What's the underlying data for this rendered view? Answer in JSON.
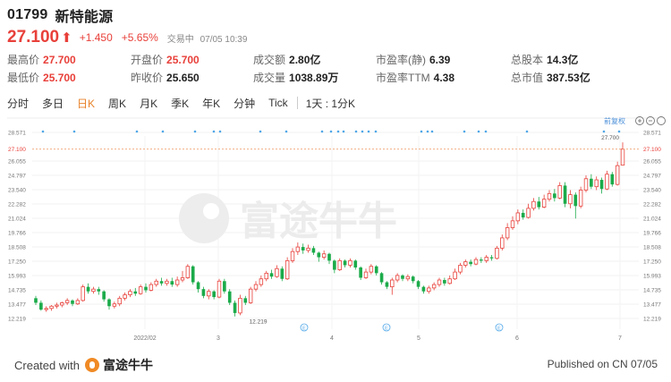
{
  "header": {
    "code": "01799",
    "name": "新特能源"
  },
  "quote": {
    "price": "27.100",
    "arrow": "⬆",
    "change": "+1.450",
    "change_pct": "+5.65%",
    "time_label": "交易中",
    "time": "07/05 10:39"
  },
  "stats": [
    {
      "label": "最高价",
      "value": "27.700",
      "color": "red"
    },
    {
      "label": "开盘价",
      "value": "25.700",
      "color": "red"
    },
    {
      "label": "成交额",
      "value": "2.80亿",
      "color": "black"
    },
    {
      "label": "市盈率(静)",
      "value": "6.39",
      "color": "black"
    },
    {
      "label": "总股本",
      "value": "14.3亿",
      "color": "black"
    },
    {
      "label": "最低价",
      "value": "25.700",
      "color": "red"
    },
    {
      "label": "昨收价",
      "value": "25.650",
      "color": "black"
    },
    {
      "label": "成交量",
      "value": "1038.89万",
      "color": "black"
    },
    {
      "label": "市盈率TTM",
      "value": "4.38",
      "color": "black"
    },
    {
      "label": "总市值",
      "value": "387.53亿",
      "color": "black"
    }
  ],
  "tabs": [
    "分时",
    "多日",
    "日K",
    "周K",
    "月K",
    "季K",
    "年K",
    "分钟",
    "Tick"
  ],
  "active_tab": "日K",
  "period": "1天 : 1分K",
  "rights_label": "前复权",
  "watermark": "富途牛牛",
  "chart_data": {
    "type": "candlestick",
    "yticks": [
      28.571,
      27.1,
      26.055,
      24.797,
      23.54,
      22.282,
      21.024,
      19.766,
      18.508,
      17.25,
      15.993,
      14.735,
      13.477,
      12.219
    ],
    "xticks": [
      "2022/02",
      "3",
      "4",
      "5",
      "6",
      "7"
    ],
    "current_price": 27.1,
    "high_label": "27.700",
    "low_label": "12.219",
    "colors": {
      "up": "#e8403a",
      "down": "#1bab4a",
      "dash": "#f0a070",
      "marker": "#4fa7e8"
    },
    "candles": [
      [
        14.0,
        13.6,
        14.2,
        13.4
      ],
      [
        13.6,
        13.0,
        13.8,
        12.9
      ],
      [
        13.0,
        13.1,
        13.3,
        12.8
      ],
      [
        13.1,
        13.3,
        13.4,
        12.9
      ],
      [
        13.3,
        13.4,
        13.6,
        13.1
      ],
      [
        13.4,
        13.6,
        13.7,
        13.2
      ],
      [
        13.6,
        13.8,
        14.0,
        13.4
      ],
      [
        13.8,
        13.5,
        13.9,
        13.3
      ],
      [
        13.5,
        13.8,
        14.0,
        13.4
      ],
      [
        13.8,
        15.0,
        15.2,
        13.7
      ],
      [
        15.0,
        14.6,
        15.3,
        14.4
      ],
      [
        14.6,
        14.8,
        15.0,
        14.4
      ],
      [
        14.8,
        14.6,
        15.0,
        14.3
      ],
      [
        14.6,
        13.9,
        14.7,
        13.7
      ],
      [
        13.9,
        13.3,
        14.0,
        13.0
      ],
      [
        13.3,
        13.5,
        13.7,
        13.1
      ],
      [
        13.5,
        14.0,
        14.2,
        13.3
      ],
      [
        14.0,
        14.3,
        14.5,
        13.8
      ],
      [
        14.3,
        14.6,
        14.8,
        14.1
      ],
      [
        14.6,
        14.4,
        14.9,
        14.2
      ],
      [
        14.4,
        15.0,
        15.2,
        14.3
      ],
      [
        15.0,
        14.7,
        15.3,
        14.5
      ],
      [
        14.7,
        15.2,
        15.4,
        14.6
      ],
      [
        15.2,
        15.5,
        15.7,
        15.0
      ],
      [
        15.5,
        15.3,
        15.8,
        15.1
      ],
      [
        15.3,
        15.5,
        15.7,
        15.1
      ],
      [
        15.5,
        15.2,
        15.8,
        15.0
      ],
      [
        15.2,
        15.6,
        15.9,
        15.0
      ],
      [
        15.6,
        15.8,
        16.4,
        15.4
      ],
      [
        15.8,
        16.8,
        17.0,
        15.7
      ],
      [
        16.8,
        15.4,
        16.9,
        15.2
      ],
      [
        15.4,
        14.8,
        15.5,
        14.5
      ],
      [
        14.8,
        14.2,
        15.0,
        14.0
      ],
      [
        14.2,
        14.6,
        14.8,
        13.9
      ],
      [
        14.6,
        14.1,
        14.7,
        13.9
      ],
      [
        14.1,
        15.5,
        15.7,
        14.0
      ],
      [
        15.5,
        14.6,
        15.7,
        14.4
      ],
      [
        14.6,
        13.6,
        14.8,
        13.4
      ],
      [
        13.6,
        12.7,
        13.8,
        12.4
      ],
      [
        12.7,
        14.0,
        14.3,
        12.5
      ],
      [
        14.0,
        13.6,
        14.2,
        13.4
      ],
      [
        13.6,
        14.8,
        15.0,
        13.5
      ],
      [
        14.8,
        15.2,
        15.5,
        14.6
      ],
      [
        15.2,
        15.7,
        16.0,
        15.0
      ],
      [
        15.7,
        16.2,
        16.4,
        15.5
      ],
      [
        16.2,
        15.9,
        16.5,
        15.7
      ],
      [
        15.9,
        16.6,
        16.9,
        15.8
      ],
      [
        16.6,
        15.7,
        16.8,
        15.5
      ],
      [
        15.7,
        17.3,
        17.6,
        15.6
      ],
      [
        17.3,
        18.1,
        18.4,
        17.1
      ],
      [
        18.1,
        18.5,
        18.9,
        17.8
      ],
      [
        18.5,
        18.2,
        18.8,
        17.9
      ],
      [
        18.2,
        18.4,
        18.7,
        18.0
      ],
      [
        18.4,
        18.0,
        18.6,
        17.8
      ],
      [
        18.0,
        17.6,
        18.1,
        17.2
      ],
      [
        17.6,
        17.9,
        18.2,
        17.4
      ],
      [
        17.9,
        17.3,
        18.0,
        17.0
      ],
      [
        17.3,
        16.5,
        17.4,
        16.2
      ],
      [
        16.5,
        17.3,
        17.5,
        16.4
      ],
      [
        17.3,
        16.9,
        17.4,
        16.7
      ],
      [
        16.9,
        17.3,
        17.5,
        16.7
      ],
      [
        17.3,
        16.7,
        17.4,
        16.5
      ],
      [
        16.7,
        15.8,
        16.8,
        15.6
      ],
      [
        15.8,
        16.3,
        16.6,
        15.7
      ],
      [
        16.3,
        16.8,
        17.0,
        16.1
      ],
      [
        16.8,
        16.2,
        16.9,
        16.0
      ],
      [
        16.2,
        15.4,
        16.3,
        15.2
      ],
      [
        15.4,
        15.0,
        15.5,
        14.8
      ],
      [
        15.0,
        15.6,
        15.8,
        14.3
      ],
      [
        15.6,
        16.0,
        16.2,
        15.4
      ],
      [
        16.0,
        15.7,
        16.1,
        15.5
      ],
      [
        15.7,
        15.9,
        16.1,
        15.5
      ],
      [
        15.9,
        15.5,
        16.0,
        15.3
      ],
      [
        15.5,
        15.0,
        15.6,
        14.8
      ],
      [
        15.0,
        14.6,
        15.1,
        14.4
      ],
      [
        14.6,
        14.9,
        15.1,
        14.4
      ],
      [
        14.9,
        15.2,
        15.4,
        14.7
      ],
      [
        15.2,
        15.6,
        15.8,
        15.0
      ],
      [
        15.6,
        15.3,
        15.8,
        15.1
      ],
      [
        15.3,
        15.7,
        16.0,
        15.2
      ],
      [
        15.7,
        16.3,
        16.6,
        15.6
      ],
      [
        16.3,
        16.9,
        17.1,
        16.1
      ],
      [
        16.9,
        17.2,
        17.4,
        16.7
      ],
      [
        17.2,
        17.0,
        17.4,
        16.8
      ],
      [
        17.0,
        17.4,
        17.6,
        16.9
      ],
      [
        17.4,
        17.3,
        17.6,
        17.1
      ],
      [
        17.3,
        17.6,
        17.8,
        17.1
      ],
      [
        17.6,
        17.5,
        17.8,
        17.3
      ],
      [
        17.5,
        18.4,
        18.6,
        17.4
      ],
      [
        18.4,
        19.3,
        19.6,
        18.2
      ],
      [
        19.3,
        20.2,
        20.6,
        19.1
      ],
      [
        20.2,
        20.8,
        21.2,
        20.0
      ],
      [
        20.8,
        21.5,
        21.8,
        20.5
      ],
      [
        21.5,
        21.1,
        21.8,
        20.9
      ],
      [
        21.1,
        21.9,
        22.3,
        21.0
      ],
      [
        21.9,
        22.5,
        22.8,
        21.7
      ],
      [
        22.5,
        22.0,
        22.9,
        21.8
      ],
      [
        22.0,
        22.7,
        23.1,
        21.9
      ],
      [
        22.7,
        23.2,
        23.5,
        22.5
      ],
      [
        23.2,
        22.8,
        23.6,
        22.5
      ],
      [
        22.8,
        23.9,
        24.2,
        22.7
      ],
      [
        23.9,
        22.3,
        24.2,
        22.0
      ],
      [
        22.3,
        23.1,
        23.5,
        21.9
      ],
      [
        23.1,
        22.1,
        23.3,
        21.0
      ],
      [
        22.1,
        23.5,
        23.8,
        21.9
      ],
      [
        23.5,
        24.5,
        24.8,
        23.3
      ],
      [
        24.5,
        23.8,
        24.9,
        23.6
      ],
      [
        23.8,
        24.4,
        24.7,
        23.5
      ],
      [
        24.4,
        23.6,
        24.6,
        23.2
      ],
      [
        23.6,
        24.9,
        25.2,
        23.5
      ],
      [
        24.9,
        24.0,
        25.1,
        23.8
      ],
      [
        24.0,
        25.65,
        26.0,
        23.9
      ],
      [
        25.7,
        27.1,
        27.7,
        25.7
      ]
    ],
    "markers_x": [
      48,
      83,
      153,
      182,
      218,
      239,
      246,
      291,
      320,
      360,
      370,
      378,
      384,
      398,
      405,
      412,
      420,
      471,
      478,
      483,
      519,
      535,
      543,
      589,
      675,
      692
    ],
    "event_x": [
      340,
      432,
      558
    ]
  }
}
